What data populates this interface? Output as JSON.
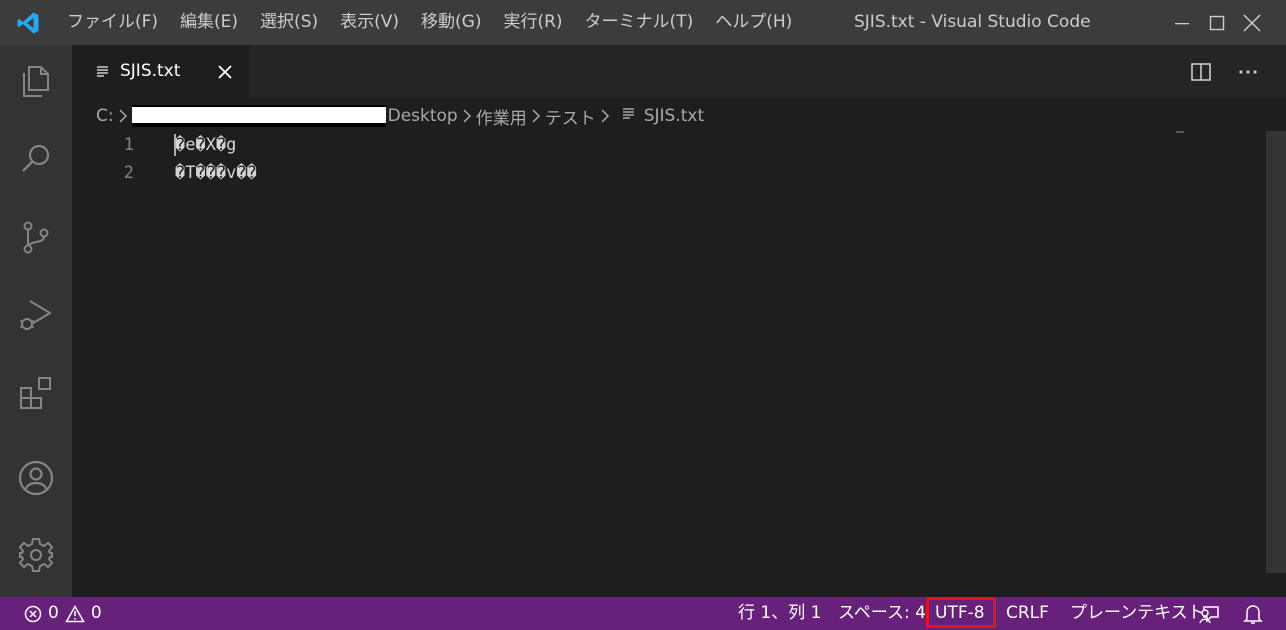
{
  "menu": {
    "file": "ファイル(F)",
    "edit": "編集(E)",
    "selection": "選択(S)",
    "view": "表示(V)",
    "go": "移動(G)",
    "run": "実行(R)",
    "terminal": "ターミナル(T)",
    "help": "ヘルプ(H)"
  },
  "window": {
    "title": "SJIS.txt - Visual Studio Code"
  },
  "tab": {
    "label": "SJIS.txt"
  },
  "breadcrumb": {
    "drive": "C:",
    "desktop": "Desktop",
    "folder1": "作業用",
    "folder2": "テスト",
    "file": "SJIS.txt"
  },
  "editor": {
    "lines": [
      {
        "number": "1",
        "text": "�e�X�g"
      },
      {
        "number": "2",
        "text": "�T���v��"
      }
    ]
  },
  "status": {
    "errors": "0",
    "warnings": "0",
    "position": "行 1、列 1",
    "spaces": "スペース: 4",
    "encoding": "UTF-8",
    "eol": "CRLF",
    "language": "プレーンテキスト"
  },
  "colors": {
    "titlebar": "#3c3c3c",
    "activitybar": "#333333",
    "statusbar": "#68217a",
    "highlight": "#e81123",
    "vscode_blue": "#23a9f2"
  },
  "icons": [
    "vscode-logo-icon",
    "explorer-icon",
    "search-icon",
    "source-control-icon",
    "run-debug-icon",
    "extensions-icon",
    "account-icon",
    "settings-gear-icon",
    "split-editor-icon",
    "more-actions-icon",
    "error-icon",
    "warning-icon",
    "feedback-icon",
    "bell-icon"
  ]
}
